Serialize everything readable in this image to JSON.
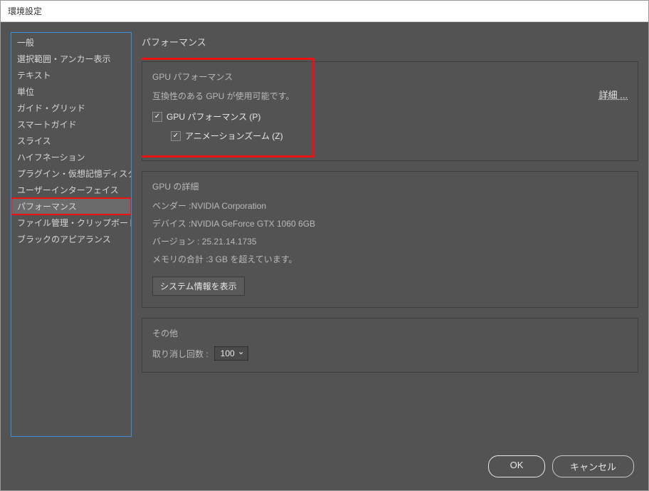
{
  "window": {
    "title": "環境設定"
  },
  "sidebar": {
    "items": [
      {
        "label": "一般"
      },
      {
        "label": "選択範囲・アンカー表示"
      },
      {
        "label": "テキスト"
      },
      {
        "label": "単位"
      },
      {
        "label": "ガイド・グリッド"
      },
      {
        "label": "スマートガイド"
      },
      {
        "label": "スライス"
      },
      {
        "label": "ハイフネーション"
      },
      {
        "label": "プラグイン・仮想記憶ディスク"
      },
      {
        "label": "ユーザーインターフェイス"
      },
      {
        "label": "パフォーマンス"
      },
      {
        "label": "ファイル管理・クリップボード"
      },
      {
        "label": "ブラックのアピアランス"
      }
    ],
    "selected_index": 10
  },
  "page": {
    "title": "パフォーマンス"
  },
  "gpu_perf": {
    "title": "GPU パフォーマンス",
    "compat_text": "互換性のある GPU が使用可能です。",
    "checkbox1_label": "GPU パフォーマンス (P)",
    "checkbox1_checked": true,
    "checkbox2_label": "アニメーションズーム (Z)",
    "checkbox2_checked": true,
    "detail_button": "詳細 ..."
  },
  "gpu_detail": {
    "title": "GPU の詳細",
    "vendor_label": "ベンダー :",
    "vendor_value": "NVIDIA Corporation",
    "device_label": "デバイス :",
    "device_value": "NVIDIA GeForce GTX 1060 6GB",
    "version_label": "バージョン :",
    "version_value": " 25.21.14.1735",
    "memory_label": "メモリの合計 :",
    "memory_value": "3 GB を超えています。",
    "sysinfo_button": "システム情報を表示"
  },
  "other": {
    "title": "その他",
    "undo_label": "取り消し回数 :",
    "undo_value": "100"
  },
  "footer": {
    "ok": "OK",
    "cancel": "キャンセル"
  }
}
